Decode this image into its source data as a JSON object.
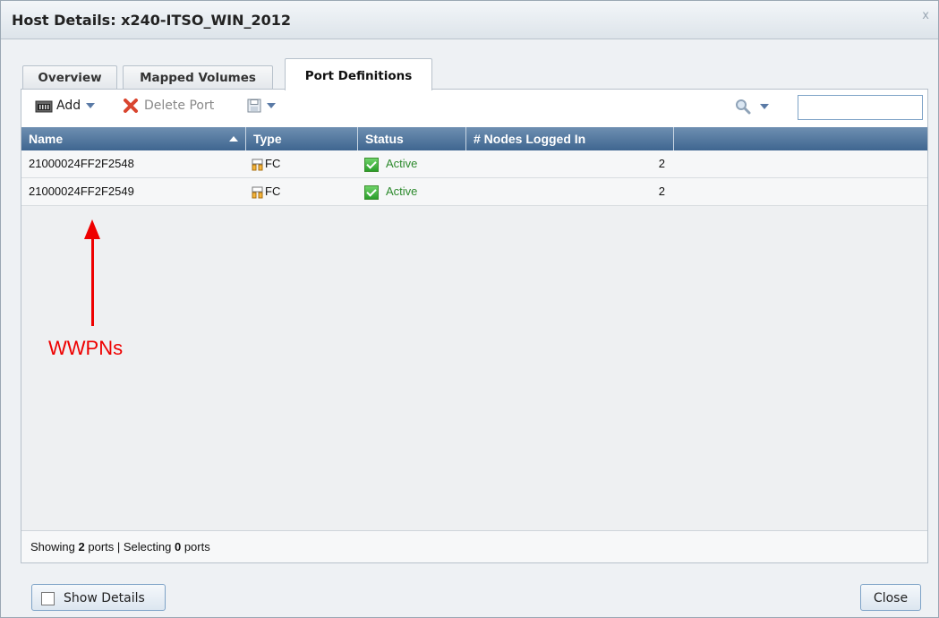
{
  "window": {
    "title": "Host Details: x240-ITSO_WIN_2012",
    "close_glyph": "x"
  },
  "tabs": [
    {
      "label": "Overview"
    },
    {
      "label": "Mapped Volumes"
    },
    {
      "label": "Port Definitions",
      "active": true
    }
  ],
  "toolbar": {
    "add_label": "Add",
    "delete_label": "Delete Port",
    "search_value": ""
  },
  "table": {
    "columns": [
      "Name",
      "Type",
      "Status",
      "# Nodes Logged In"
    ],
    "sort": {
      "column": "Name",
      "direction": "ascending"
    },
    "rows": [
      {
        "name": "21000024FF2F2548",
        "type": "FC",
        "status": "Active",
        "nodes": "2"
      },
      {
        "name": "21000024FF2F2549",
        "type": "FC",
        "status": "Active",
        "nodes": "2"
      }
    ]
  },
  "status_bar": {
    "prefix": "Showing",
    "ports_count": "2",
    "middle": "ports | Selecting",
    "selected_count": "0",
    "suffix": "ports"
  },
  "footer": {
    "show_details_label": "Show Details",
    "close_label": "Close"
  },
  "annotation": {
    "text": "WWPNs",
    "color": "#ee0000"
  },
  "colors": {
    "header_bg": "#4f739b",
    "active_status": "#2d8a2d",
    "accent_border": "#7ea3c7"
  },
  "icons": {
    "add": "host-port-icon",
    "delete": "red-x-icon",
    "save": "floppy-disk-icon",
    "search": "magnifier-icon",
    "type": "fc-port-icon",
    "status": "green-check-icon"
  }
}
